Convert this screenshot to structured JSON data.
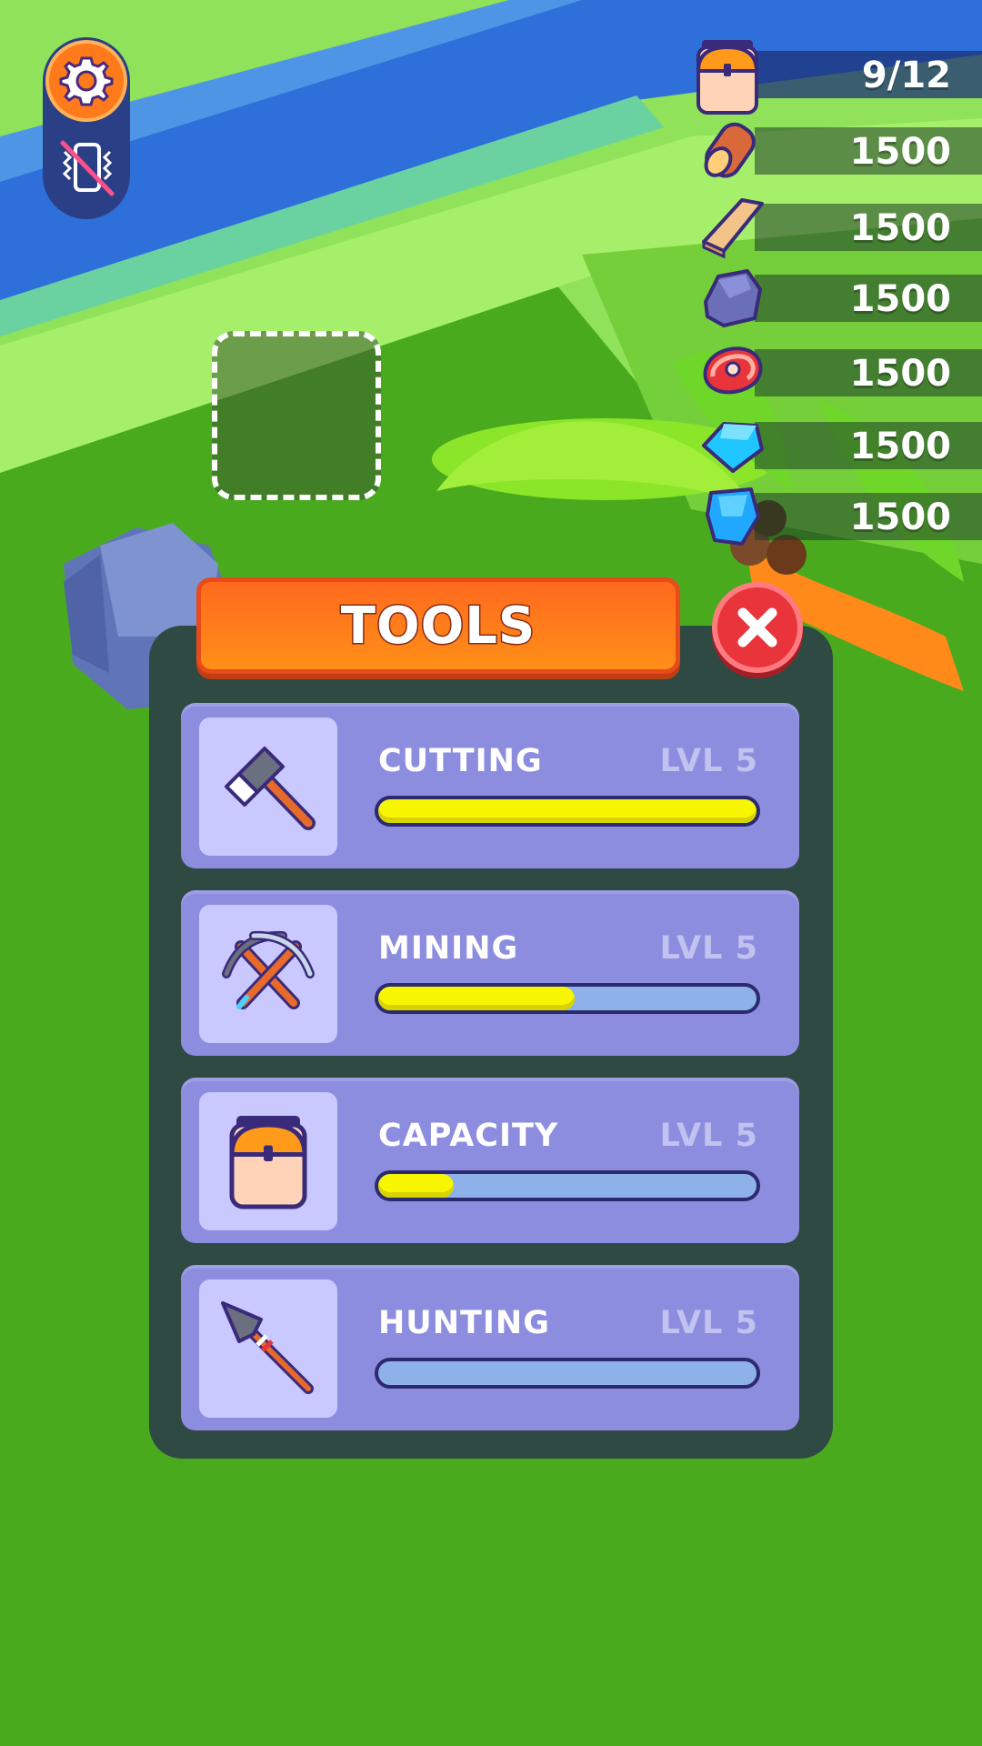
{
  "hud": {
    "capacity": "9/12",
    "resources": [
      {
        "icon": "wood-log-icon",
        "value": "1500"
      },
      {
        "icon": "plank-icon",
        "value": "1500"
      },
      {
        "icon": "stone-icon",
        "value": "1500"
      },
      {
        "icon": "meat-icon",
        "value": "1500"
      },
      {
        "icon": "crystal-icon",
        "value": "1500"
      },
      {
        "icon": "gem-icon",
        "value": "1500"
      }
    ]
  },
  "dialog": {
    "title": "TOOLS",
    "tools": [
      {
        "name": "CUTTING",
        "level": "LVL 5",
        "icon": "axe-icon",
        "progress": 1.0
      },
      {
        "name": "MINING",
        "level": "LVL 5",
        "icon": "pickaxe-icon",
        "progress": 0.52
      },
      {
        "name": "CAPACITY",
        "level": "LVL 5",
        "icon": "backpack-icon",
        "progress": 0.2
      },
      {
        "name": "HUNTING",
        "level": "LVL 5",
        "icon": "spear-icon",
        "progress": 0.0
      }
    ]
  },
  "colors": {
    "accent_orange": "#ff7a1a",
    "progress_fill": "#f8f500",
    "card_bg": "#8d8de0",
    "close_red": "#e8343a"
  }
}
